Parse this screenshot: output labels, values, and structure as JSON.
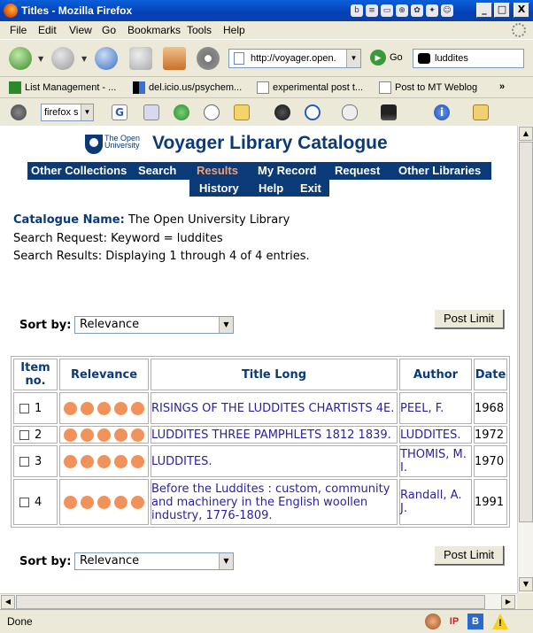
{
  "window": {
    "title": "Titles - Mozilla Firefox",
    "controls": {
      "minimize": "_",
      "maximize": "□",
      "close": "X"
    }
  },
  "menu": [
    "File",
    "Edit",
    "View",
    "Go",
    "Bookmarks",
    "Tools",
    "Help"
  ],
  "nav": {
    "url": "http://voyager.open.",
    "go_label": "Go",
    "search_value": "luddites"
  },
  "bookmarks": {
    "items": [
      "List Management - ...",
      "del.icio.us/psychem...",
      "experimental post t...",
      "Post to MT Weblog"
    ],
    "overflow": "»"
  },
  "toolbar": {
    "search_engine": "firefox s"
  },
  "page": {
    "logo_text": [
      "The Open",
      "University"
    ],
    "title": "Voyager Library Catalogue",
    "menu_row1": [
      "Other Collections",
      "Search",
      "Results",
      "My Record",
      "Request",
      "Other Libraries"
    ],
    "menu_row2": [
      "History",
      "Help",
      "Exit"
    ],
    "active_menu": "Results",
    "catalogue_label": "Catalogue Name:",
    "catalogue_value": "The Open University Library",
    "search_request": "Search Request: Keyword = luddites",
    "search_results": "Search Results: Displaying 1 through 4 of 4 entries.",
    "sort_label": "Sort by:",
    "sort_value": "Relevance",
    "post_limit_label": "Post Limit",
    "columns": [
      "Item no.",
      "Relevance",
      "Title Long",
      "Author",
      "Date"
    ],
    "results": [
      {
        "no": "1",
        "relevance": 5,
        "title": "RISINGS OF THE LUDDITES CHARTISTS 4E.",
        "author": "PEEL, F.",
        "date": "1968"
      },
      {
        "no": "2",
        "relevance": 5,
        "title": "LUDDITES THREE PAMPHLETS 1812 1839.",
        "author": "LUDDITES.",
        "date": "1972"
      },
      {
        "no": "3",
        "relevance": 5,
        "title": "LUDDITES.",
        "author": "THOMIS, M. I.",
        "date": "1970"
      },
      {
        "no": "4",
        "relevance": 5,
        "title": "Before the Luddites : custom, community and machinery in the English woollen industry, 1776-1809.",
        "author": "Randall, A. J.",
        "date": "1991"
      }
    ]
  },
  "status": {
    "text": "Done",
    "ip_badge": "IP",
    "b_badge": "B",
    "warn_badge": "!"
  },
  "colors": {
    "brand": "#0a3a78",
    "active_menu": "#f0a070",
    "relevance_dot": "#f0925a",
    "link": "#2a1fa0"
  }
}
